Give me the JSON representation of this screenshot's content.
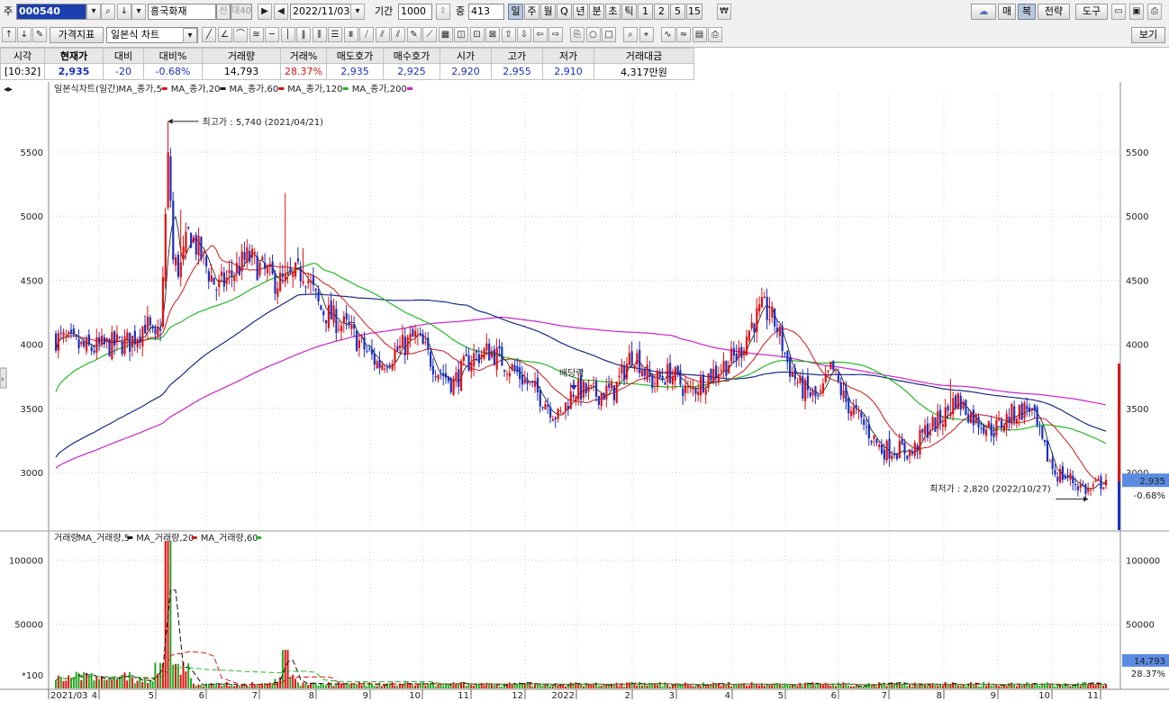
{
  "toolbar": {
    "code_label": "주",
    "code": "000540",
    "name": "흥국화재",
    "date": "2022/11/03",
    "period_label": "기간",
    "period": "1000",
    "count_label": "중",
    "count": "413",
    "tabs": [
      "일",
      "주",
      "월",
      "Q",
      "년",
      "분",
      "초",
      "틱",
      "1",
      "2",
      "5",
      "15"
    ],
    "active_tab": "일",
    "right_buttons": [
      "매",
      "복",
      "전략",
      "도구"
    ],
    "indicator_btn": "가격지표",
    "chart_type": "일본식 차트",
    "view_btn": "보기",
    "badge1": "신",
    "badge2": "대40"
  },
  "quote": {
    "headers": [
      "시각",
      "현재가",
      "대비",
      "대비%",
      "거래량",
      "거래%",
      "매도호가",
      "매수호가",
      "시가",
      "고가",
      "저가",
      "거래대금"
    ],
    "values": [
      "[10:32]",
      "2,935",
      "-20",
      "-0.68%",
      "14,793",
      "28.37%",
      "2,935",
      "2,925",
      "2,920",
      "2,955",
      "2,910",
      "4,317만원"
    ]
  },
  "colors": {
    "up": "#e01010",
    "down": "#1a2fc0",
    "ma5": "#e01010",
    "ma20": "#d01818",
    "ma60": "#22bb22",
    "ma120": "#1a2a8a",
    "ma200": "#cc22cc"
  },
  "chart_data": [
    {
      "type": "candlestick",
      "title": "일본식차트(일간)",
      "legend": [
        "MA_종가,5",
        "MA_종가,20",
        "MA_종가,60",
        "MA_종가,120",
        "MA_종가,200"
      ],
      "ylim": [
        2550,
        5950
      ],
      "yticks": [
        3000,
        3500,
        4000,
        4500,
        5000,
        5500
      ],
      "x_month_labels": [
        "2021/03",
        "4",
        "5",
        "6",
        "7",
        "8",
        "9",
        "10",
        "11",
        "12",
        "2022",
        "2",
        "3",
        "4",
        "5",
        "6",
        "7",
        "8",
        "9",
        "10",
        "11"
      ],
      "anchors": [
        {
          "m": 0.0,
          "v": 4050
        },
        {
          "m": 0.5,
          "v": 3960
        },
        {
          "m": 1.2,
          "v": 4020
        },
        {
          "m": 1.45,
          "v": 4170
        },
        {
          "m": 1.6,
          "v": 4000
        },
        {
          "m": 1.7,
          "v": 4200
        },
        {
          "m": 1.78,
          "v": 5150
        },
        {
          "m": 1.82,
          "v": 5560
        },
        {
          "m": 1.88,
          "v": 4650
        },
        {
          "m": 2.0,
          "v": 4580
        },
        {
          "m": 2.15,
          "v": 4880
        },
        {
          "m": 2.6,
          "v": 4430
        },
        {
          "m": 3.1,
          "v": 4680
        },
        {
          "m": 3.5,
          "v": 4500
        },
        {
          "m": 3.7,
          "v": 4480
        },
        {
          "m": 4.0,
          "v": 4580
        },
        {
          "m": 4.25,
          "v": 4280
        },
        {
          "m": 4.7,
          "v": 4120
        },
        {
          "m": 5.0,
          "v": 3950
        },
        {
          "m": 5.2,
          "v": 3840
        },
        {
          "m": 5.5,
          "v": 3950
        },
        {
          "m": 5.8,
          "v": 4060
        },
        {
          "m": 6.15,
          "v": 3800
        },
        {
          "m": 6.4,
          "v": 3700
        },
        {
          "m": 6.7,
          "v": 3900
        },
        {
          "m": 7.0,
          "v": 3950
        },
        {
          "m": 7.4,
          "v": 3790
        },
        {
          "m": 7.9,
          "v": 3550
        },
        {
          "m": 8.1,
          "v": 3420
        },
        {
          "m": 8.35,
          "v": 3650
        },
        {
          "m": 8.7,
          "v": 3610
        },
        {
          "m": 9.0,
          "v": 3640
        },
        {
          "m": 9.3,
          "v": 3950
        },
        {
          "m": 9.6,
          "v": 3700
        },
        {
          "m": 9.9,
          "v": 3780
        },
        {
          "m": 10.2,
          "v": 3620
        },
        {
          "m": 10.5,
          "v": 3750
        },
        {
          "m": 10.8,
          "v": 3850
        },
        {
          "m": 11.0,
          "v": 3920
        },
        {
          "m": 11.2,
          "v": 4150
        },
        {
          "m": 11.4,
          "v": 4280
        },
        {
          "m": 11.6,
          "v": 4160
        },
        {
          "m": 11.8,
          "v": 3840
        },
        {
          "m": 12.0,
          "v": 3660
        },
        {
          "m": 12.3,
          "v": 3560
        },
        {
          "m": 12.5,
          "v": 3820
        },
        {
          "m": 12.7,
          "v": 3570
        },
        {
          "m": 13.0,
          "v": 3380
        },
        {
          "m": 13.3,
          "v": 3180
        },
        {
          "m": 13.6,
          "v": 3180
        },
        {
          "m": 13.8,
          "v": 3150
        },
        {
          "m": 14.0,
          "v": 3320
        },
        {
          "m": 14.3,
          "v": 3430
        },
        {
          "m": 14.5,
          "v": 3580
        },
        {
          "m": 14.8,
          "v": 3420
        },
        {
          "m": 15.1,
          "v": 3330
        },
        {
          "m": 15.4,
          "v": 3450
        },
        {
          "m": 15.7,
          "v": 3510
        },
        {
          "m": 15.9,
          "v": 3200
        },
        {
          "m": 16.1,
          "v": 3000
        },
        {
          "m": 16.3,
          "v": 2960
        },
        {
          "m": 16.65,
          "v": 2850
        },
        {
          "m": 16.92,
          "v": 2950
        }
      ],
      "annotations": {
        "high": "최고가 : 5,740 (2021/04/21)",
        "low": "최저가 : 2,820 (2022/10/27)",
        "dividend": "배당락"
      },
      "last_price": "2,935",
      "last_change": "-0.68%"
    },
    {
      "type": "bar",
      "title": "거래량",
      "legend": [
        "MA_거래량,5",
        "MA_거래량,20",
        "MA_거래량,60"
      ],
      "ylim": [
        0,
        115000
      ],
      "yticks": [
        50000,
        100000
      ],
      "unit": "*100",
      "last_volume": "14,793",
      "last_ratio": "28.37%"
    }
  ]
}
